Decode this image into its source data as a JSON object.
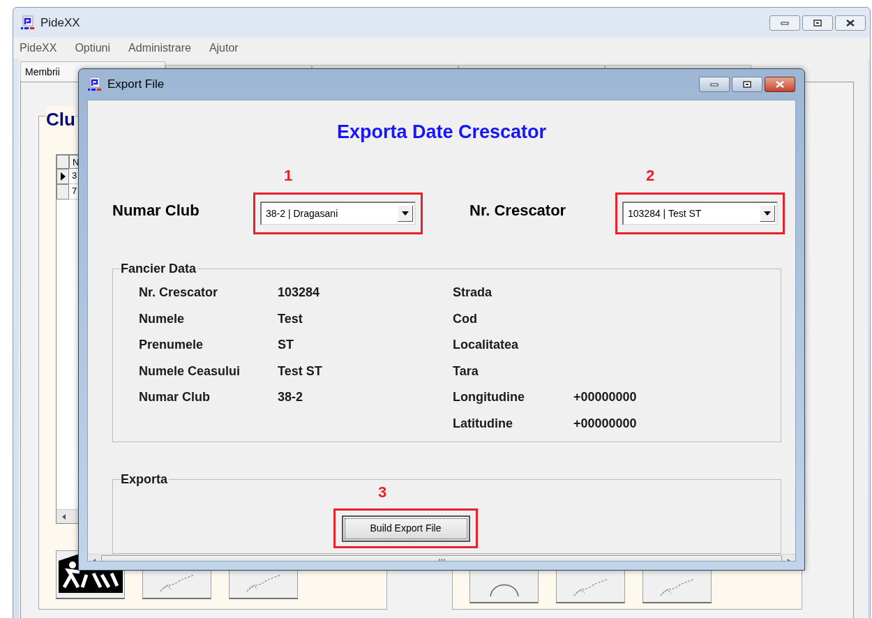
{
  "main_window": {
    "title": "PideXX",
    "menu": [
      "PideXX",
      "Optiuni",
      "Administrare",
      "Ajutor"
    ],
    "tabs": [
      {
        "label": "Membrii",
        "selected": true
      }
    ],
    "group_title": "Clu",
    "grid": {
      "header": "N",
      "rows": [
        {
          "cell": "3",
          "selected": true
        },
        {
          "cell": "7",
          "selected": false
        }
      ]
    }
  },
  "dialog": {
    "title": "Export File",
    "heading": "Exporta Date Crescator",
    "selectors": [
      {
        "marker": "1",
        "label": "Numar Club",
        "value": "38-2 | Dragasani"
      },
      {
        "marker": "2",
        "label": "Nr. Crescator",
        "value": "103284 | Test ST"
      }
    ],
    "fancier_data": {
      "title": "Fancier Data",
      "left": [
        {
          "label": "Nr. Crescator",
          "value": "103284"
        },
        {
          "label": "Numele",
          "value": "Test"
        },
        {
          "label": "Prenumele",
          "value": "ST"
        },
        {
          "label": "Numele Ceasului",
          "value": "Test ST"
        },
        {
          "label": "Numar Club",
          "value": "38-2"
        }
      ],
      "right": [
        {
          "label": "Strada"
        },
        {
          "label": "Cod"
        },
        {
          "label": "Localitatea"
        },
        {
          "label": "Tara"
        },
        {
          "label": "Longitudine",
          "value": "+00000000"
        },
        {
          "label": "Latitudine",
          "value": "+00000000"
        }
      ]
    },
    "export": {
      "title": "Exporta",
      "marker": "3",
      "button": "Build Export File"
    }
  }
}
